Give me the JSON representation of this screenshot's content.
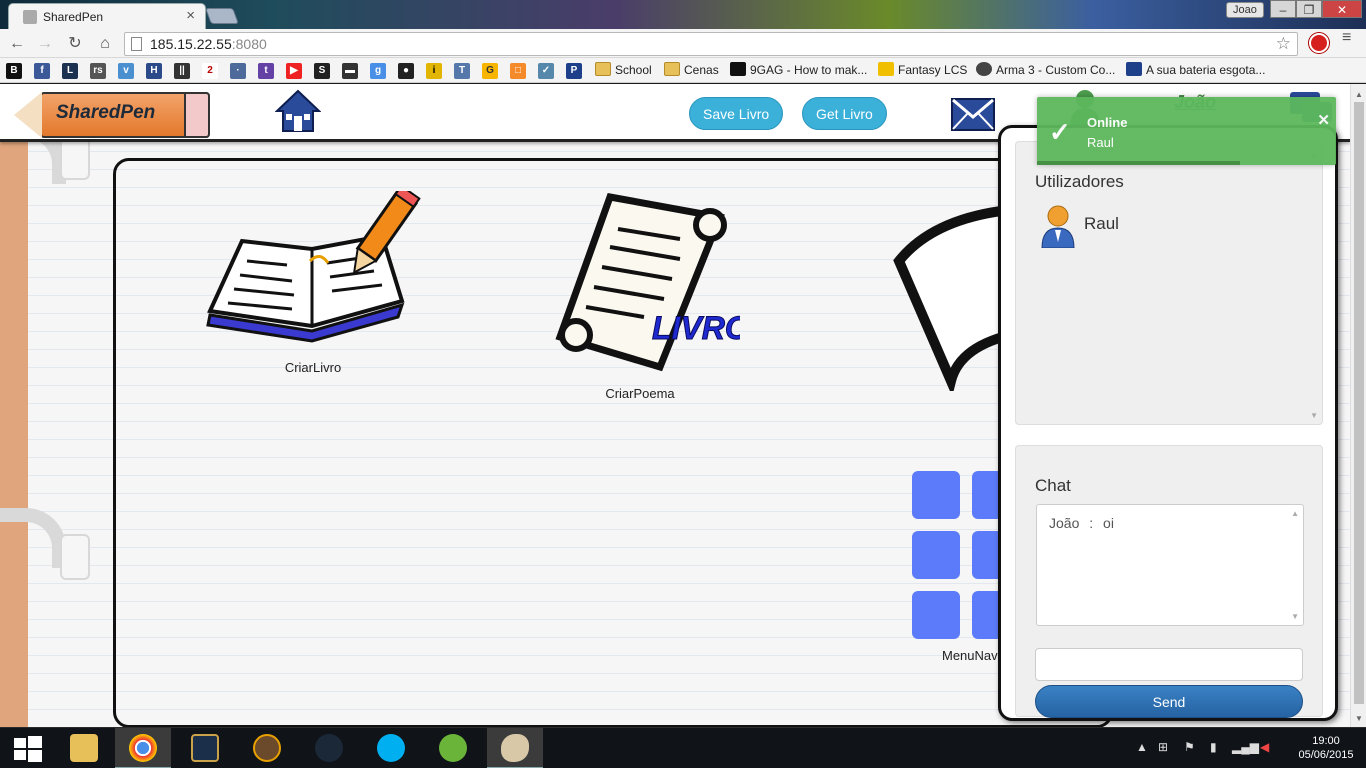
{
  "browser": {
    "tab_title": "SharedPen",
    "profile_name": "Joao",
    "url_host": "185.15.22.55",
    "url_port": ":8080",
    "bookmarks": [
      {
        "label": "School",
        "icon": "folder-icon"
      },
      {
        "label": "Cenas",
        "icon": "folder-icon"
      },
      {
        "label": "9GAG - How to mak...",
        "icon": "9gag-icon"
      },
      {
        "label": "Fantasy LCS",
        "icon": "fantasy-icon"
      },
      {
        "label": "Arma 3 - Custom Co...",
        "icon": "arma-icon"
      },
      {
        "label": "A sua bateria esgota...",
        "icon": "p-icon"
      }
    ]
  },
  "header": {
    "logo_text": "SharedPen",
    "save_button": "Save Livro",
    "get_button": "Get Livro",
    "username": "João"
  },
  "apps": [
    {
      "label": "CriarLivro"
    },
    {
      "label": "CriarPoema",
      "badge": "LIVRO"
    },
    {
      "label": "MenuNav"
    }
  ],
  "panel": {
    "users_title": "Utilizadores",
    "users": [
      {
        "name": "Raul"
      }
    ],
    "chat_title": "Chat",
    "messages": [
      {
        "from": "João",
        "sep": ":",
        "text": "oi"
      }
    ],
    "send_label": "Send",
    "input_value": ""
  },
  "toast": {
    "title": "Online",
    "message": "Raul",
    "progress": 0.68,
    "color": "#5cb85c"
  },
  "taskbar": {
    "time": "19:00",
    "date": "05/06/2015"
  }
}
